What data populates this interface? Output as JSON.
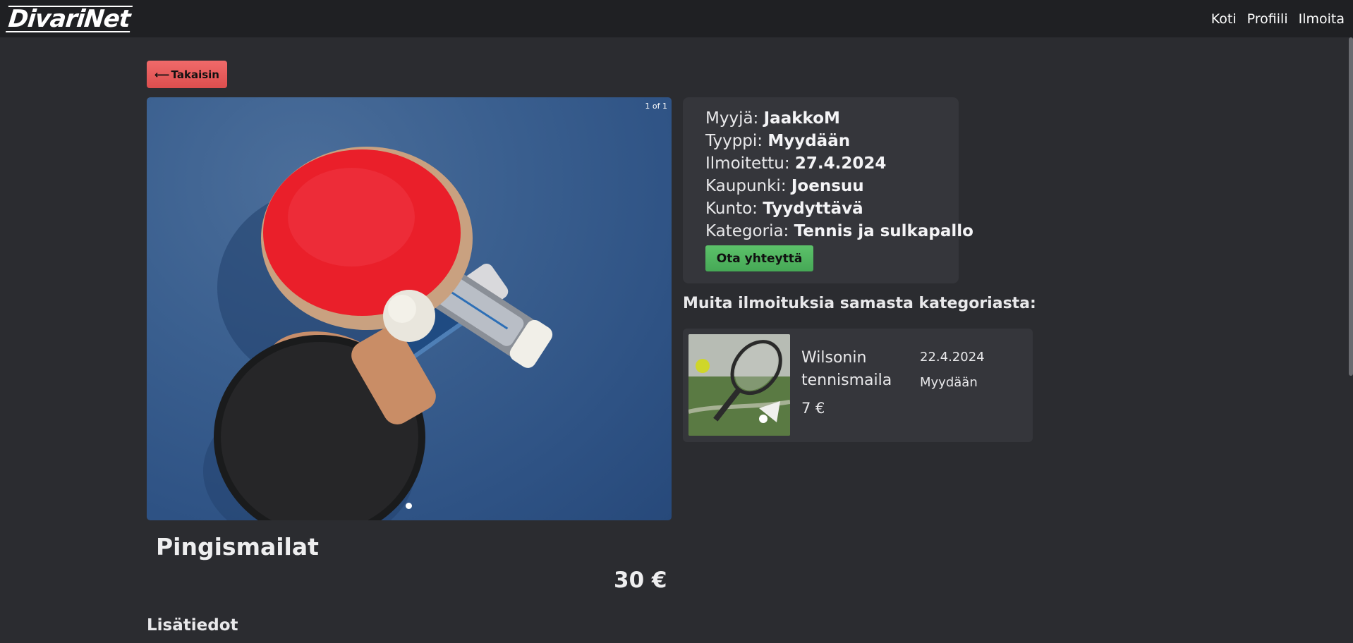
{
  "navbar": {
    "logo": "DivariNet",
    "links": [
      "Koti",
      "Profiili",
      "Ilmoita"
    ]
  },
  "back_button": {
    "arrow": "⟵",
    "label": "Takaisin"
  },
  "carousel": {
    "counter": "1 of 1",
    "image": "table-tennis-paddles-photo"
  },
  "listing": {
    "seller_label": "Myyjä:",
    "seller": "JaakkoM",
    "type_label": "Tyyppi:",
    "type": "Myydään",
    "posted_label": "Ilmoitettu:",
    "posted": "27.4.2024",
    "city_label": "Kaupunki:",
    "city": "Joensuu",
    "condition_label": "Kunto:",
    "condition": "Tyydyttävä",
    "category_label": "Kategoria:",
    "category": "Tennis ja sulkapallo",
    "contact_button": "Ota yhteyttä",
    "title": "Pingismailat",
    "price": "30 €",
    "details_heading": "Lisätiedot"
  },
  "related": {
    "heading": "Muita ilmoituksia samasta kategoriasta:",
    "items": [
      {
        "title": "Wilsonin tennismaila",
        "price": "7 €",
        "date": "22.4.2024",
        "type": "Myydään",
        "image": "tennis-racket-photo"
      }
    ]
  },
  "colors": {
    "background": "#2b2c30",
    "navbar": "#1f2023",
    "card": "#35363b",
    "back_button": "#e85a5a",
    "contact_button": "#52b660"
  }
}
